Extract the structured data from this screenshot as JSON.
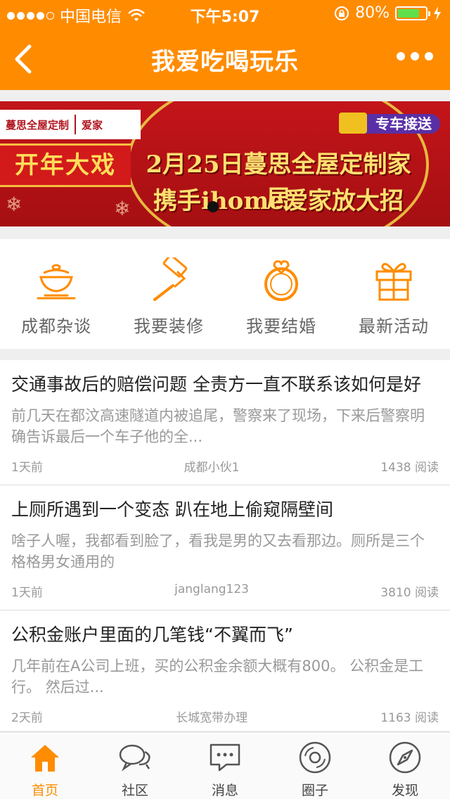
{
  "status_bar": {
    "carrier": "中国电信",
    "time": "下午5:07",
    "battery": "80%",
    "battery_level": 0.8
  },
  "navbar": {
    "title": "我爱吃喝玩乐"
  },
  "banner": {
    "brand_left": "蔓思全屋定制",
    "brand_right": "爱家",
    "bus_label": "专车接送",
    "badge": "开年大戏",
    "line1": "2月25日蔓思全屋定制家居",
    "line2": "携手ihome爱家放大招"
  },
  "categories": [
    {
      "label": "成都杂谈",
      "icon": "tea-bowl-icon"
    },
    {
      "label": "我要装修",
      "icon": "paint-roller-icon"
    },
    {
      "label": "我要结婚",
      "icon": "ring-icon"
    },
    {
      "label": "最新活动",
      "icon": "gift-icon"
    }
  ],
  "articles": [
    {
      "title": "交通事故后的赔偿问题 全责方一直不联系该如何是好",
      "excerpt": "前几天在都汶高速隧道内被追尾，警察来了现场，下来后警察明确告诉最后一个车子他的全...",
      "time": "1天前",
      "author": "成都小伙1",
      "reads": "1438 阅读"
    },
    {
      "title": "上厕所遇到一个变态 趴在地上偷窥隔壁间",
      "excerpt": "啥子人喔，我都看到脸了，看我是男的又去看那边。厕所是三个格格男女通用的",
      "time": "1天前",
      "author": "janglang123",
      "reads": "3810 阅读"
    },
    {
      "title": "公积金账户里面的几笔钱“不翼而飞”",
      "excerpt": "几年前在A公司上班，买的公积金余额大概有800。 公积金是工行。 然后过...",
      "time": "2天前",
      "author": "长城宽带办理",
      "reads": "1163 阅读"
    }
  ],
  "tabs": [
    {
      "label": "首页",
      "icon": "home-icon",
      "active": true
    },
    {
      "label": "社区",
      "icon": "chat-bubbles-icon",
      "active": false
    },
    {
      "label": "消息",
      "icon": "message-icon",
      "active": false
    },
    {
      "label": "圈子",
      "icon": "disc-icon",
      "active": false
    },
    {
      "label": "发现",
      "icon": "compass-icon",
      "active": false
    }
  ],
  "colors": {
    "accent": "#ff8c00",
    "banner_red": "#b0141e"
  }
}
